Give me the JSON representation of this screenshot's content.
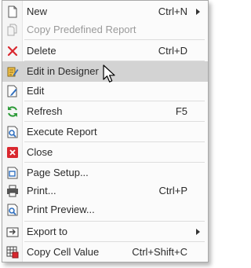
{
  "menu": {
    "items": [
      {
        "label": "New",
        "shortcut": "Ctrl+N",
        "icon": "new-document-icon"
      },
      {
        "label": "Copy Predefined Report",
        "shortcut": "",
        "icon": "copy-report-icon"
      },
      {
        "label": "Delete",
        "shortcut": "Ctrl+D",
        "icon": "delete-x-icon"
      },
      {
        "label": "Edit in Designer",
        "shortcut": "",
        "icon": "edit-in-designer-icon"
      },
      {
        "label": "Edit",
        "shortcut": "",
        "icon": "edit-icon"
      },
      {
        "label": "Refresh",
        "shortcut": "F5",
        "icon": "refresh-icon"
      },
      {
        "label": "Execute Report",
        "shortcut": "",
        "icon": "execute-report-icon"
      },
      {
        "label": "Close",
        "shortcut": "",
        "icon": "close-icon"
      },
      {
        "label": "Page Setup...",
        "shortcut": "",
        "icon": "page-setup-icon"
      },
      {
        "label": "Print...",
        "shortcut": "Ctrl+P",
        "icon": "print-icon"
      },
      {
        "label": "Print Preview...",
        "shortcut": "",
        "icon": "print-preview-icon"
      },
      {
        "label": "Export to",
        "shortcut": "",
        "icon": "export-icon"
      },
      {
        "label": "Copy Cell Value",
        "shortcut": "Ctrl+Shift+C",
        "icon": "copy-cell-value-icon"
      }
    ],
    "colors": {
      "hover_bg": "#d3d3d3",
      "disabled_text": "#9a9a9a",
      "delete_red": "#d9272e",
      "refresh_green": "#2e9b3a",
      "accent_blue": "#2f6fbf"
    }
  }
}
